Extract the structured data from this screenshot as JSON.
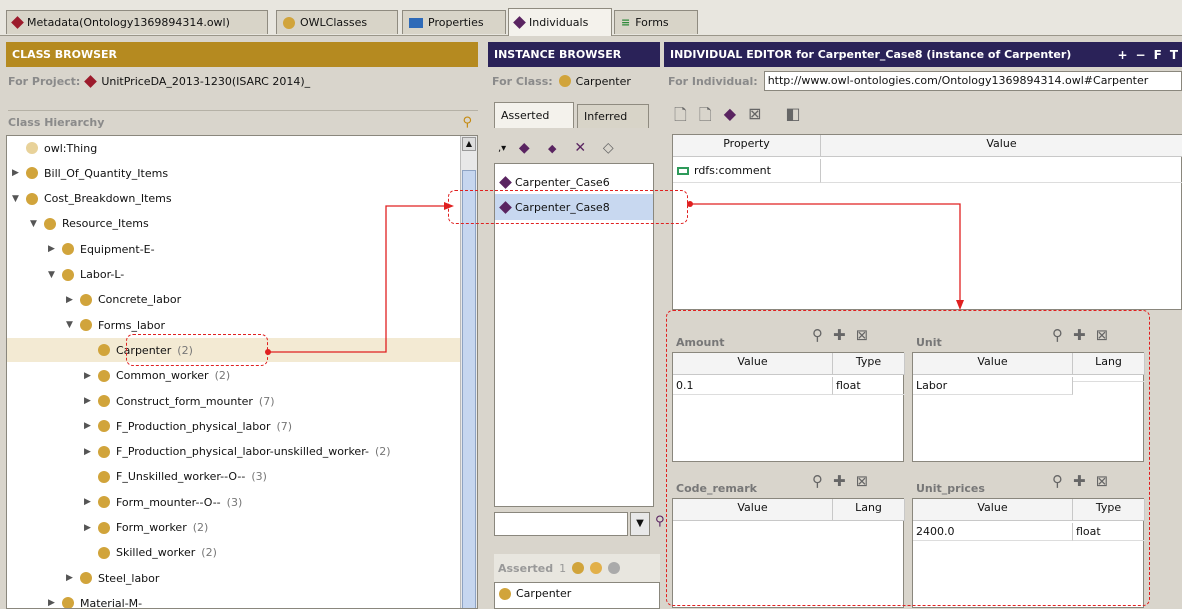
{
  "tabs": [
    {
      "label": "Metadata(Ontology1369894314.owl)",
      "icon": "red-diamond-icon"
    },
    {
      "label": "OWLClasses",
      "icon": "class-icon"
    },
    {
      "label": "Properties",
      "icon": "property-icon"
    },
    {
      "label": "Individuals",
      "icon": "individual-icon"
    },
    {
      "label": "Forms",
      "icon": "forms-icon"
    }
  ],
  "class_browser": {
    "header": "CLASS BROWSER",
    "for_project_label": "For Project:",
    "project_name": "UnitPriceDA_2013-1230(ISARC 2014)_",
    "hierarchy_label": "Class Hierarchy",
    "tree": [
      {
        "label": "owl:Thing",
        "count": "",
        "toggle": ""
      },
      {
        "label": "Bill_Of_Quantity_Items",
        "count": "",
        "toggle": "▶"
      },
      {
        "label": "Cost_Breakdown_Items",
        "count": "",
        "toggle": "▼"
      },
      {
        "label": "Resource_Items",
        "count": "",
        "toggle": "▼"
      },
      {
        "label": "Equipment-E-",
        "count": "",
        "toggle": "▶"
      },
      {
        "label": "Labor-L-",
        "count": "",
        "toggle": "▼"
      },
      {
        "label": "Concrete_labor",
        "count": "",
        "toggle": "▶"
      },
      {
        "label": "Forms_labor",
        "count": "",
        "toggle": "▼"
      },
      {
        "label": "Carpenter",
        "count": "(2)",
        "toggle": ""
      },
      {
        "label": "Common_worker",
        "count": "(2)",
        "toggle": "▶"
      },
      {
        "label": "Construct_form_mounter",
        "count": "(7)",
        "toggle": "▶"
      },
      {
        "label": "F_Production_physical_labor",
        "count": "(7)",
        "toggle": "▶"
      },
      {
        "label": "F_Production_physical_labor-unskilled_worker-",
        "count": "(2)",
        "toggle": "▶"
      },
      {
        "label": "F_Unskilled_worker--O--",
        "count": "(3)",
        "toggle": ""
      },
      {
        "label": "Form_mounter--O--",
        "count": "(3)",
        "toggle": "▶"
      },
      {
        "label": "Form_worker",
        "count": "(2)",
        "toggle": "▶"
      },
      {
        "label": "Skilled_worker",
        "count": "(2)",
        "toggle": ""
      },
      {
        "label": "Steel_labor",
        "count": "",
        "toggle": "▶"
      },
      {
        "label": "Material-M-",
        "count": "",
        "toggle": "▶"
      }
    ]
  },
  "instance_browser": {
    "header": "INSTANCE BROWSER",
    "for_class_label": "For Class:",
    "class_name": "Carpenter",
    "tab_asserted": "Asserted",
    "tab_inferred": "Inferred",
    "instances": [
      "Carpenter_Case6",
      "Carpenter_Case8"
    ],
    "search_value": "",
    "asserted_label": "Asserted",
    "asserted_count": "1",
    "asserted_class": "Carpenter"
  },
  "individual_editor": {
    "header": "INDIVIDUAL EDITOR for Carpenter_Case8  (instance of Carpenter)",
    "header_buttons": [
      "+",
      "−",
      "F",
      "T"
    ],
    "for_individual_label": "For Individual:",
    "individual_uri": "http://www.owl-ontologies.com/Ontology1369894314.owl#Carpenter",
    "prop_table": {
      "columns": [
        "Property",
        "Value"
      ],
      "rows": [
        {
          "property": "rdfs:comment",
          "value": ""
        }
      ]
    },
    "widgets": [
      {
        "name": "Amount",
        "columns": [
          "Value",
          "Type"
        ],
        "rows": [
          [
            "0.1",
            "float"
          ]
        ]
      },
      {
        "name": "Unit",
        "columns": [
          "Value",
          "Lang"
        ],
        "rows": [
          [
            "Labor",
            ""
          ]
        ]
      },
      {
        "name": "Code_remark",
        "columns": [
          "Value",
          "Lang"
        ],
        "rows": []
      },
      {
        "name": "Unit_prices",
        "columns": [
          "Value",
          "Type"
        ],
        "rows": [
          [
            "2400.0",
            "float"
          ]
        ]
      }
    ]
  },
  "colors": {
    "class_header": "#b58a20",
    "instance_header": "#2a2258",
    "editor_header": "#2a2258",
    "highlight": "#e02020",
    "selection": "#c8d8f0",
    "row_selected": "#f3ead3"
  }
}
